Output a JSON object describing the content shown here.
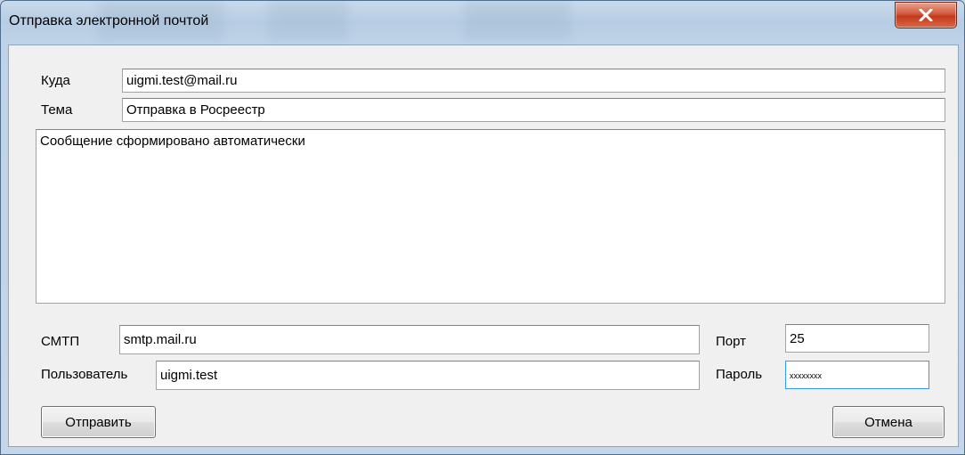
{
  "window": {
    "title": "Отправка электронной почтой"
  },
  "form": {
    "to": {
      "label": "Куда",
      "value": "uigmi.test@mail.ru"
    },
    "subject": {
      "label": "Тема",
      "value": "Отправка в Росреестр"
    },
    "body": {
      "value": "Сообщение сформировано автоматически"
    },
    "smtp": {
      "label": "СМТП",
      "value": "smtp.mail.ru"
    },
    "port": {
      "label": "Порт",
      "value": "25"
    },
    "user": {
      "label": "Пользователь",
      "value": "uigmi.test"
    },
    "password": {
      "label": "Пароль",
      "value": "xxxxxxxx"
    }
  },
  "buttons": {
    "send": "Отправить",
    "cancel": "Отмена"
  },
  "icons": {
    "close": "close-icon"
  },
  "colors": {
    "close_button": "#c3391c",
    "focus_border": "#3399ff",
    "frame": "#c7d6e6"
  }
}
